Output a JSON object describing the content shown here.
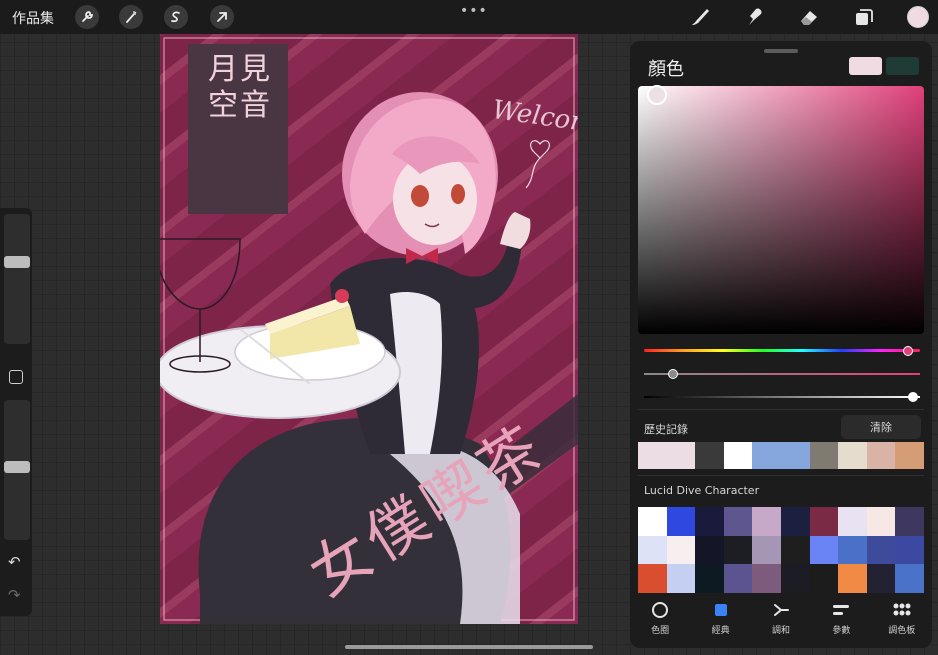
{
  "topbar": {
    "gallery_label": "作品集",
    "left_tools": [
      "wrench-icon",
      "magic-wand-icon",
      "selection-icon",
      "transform-arrow-icon"
    ],
    "right_tools": [
      "brush-icon",
      "smudge-icon",
      "eraser-icon",
      "layers-icon"
    ],
    "more_icon": "ellipsis-icon",
    "current_color": "#f0dbe2"
  },
  "sidebar": {
    "brush_size_level": 0.64,
    "opacity_level": 0.52,
    "undo_icon": "undo-icon",
    "redo_icon": "redo-icon"
  },
  "artwork": {
    "title_vertical": "月見\n空音",
    "big_title": "女僕喫茶",
    "handwriting": "Welcom"
  },
  "color_panel": {
    "title": "顏色",
    "primary_swatch": "#f0dbe2",
    "secondary_swatch": "#1f3b36",
    "hue_color": "#e0407a",
    "history_label": "歷史記錄",
    "clear_label": "清除",
    "history_swatches": [
      "#ecdce3",
      "#ecdce3",
      "#3a3a3a",
      "#ffffff",
      "#85a7dd",
      "#85a7dd",
      "#7f7a72",
      "#e4dccc",
      "#d9b3a6",
      "#d49d75"
    ],
    "palette_name": "Lucid Dive Character",
    "palette_swatches": [
      "#ffffff",
      "#2f49e0",
      "#1a1a3d",
      "#5e568f",
      "#c7a8c8",
      "#1c2040",
      "#7a2a44",
      "#e8e2f3",
      "#f7e7e5",
      "#3e3760",
      "#dde2f7",
      "#f7eeef",
      "#141628",
      "#1d1d24",
      "#a596b6",
      "#1e1e1e",
      "#6a84f5",
      "#4a70c8",
      "#3e4a9a",
      "#3b4aa0",
      "#d94e2e",
      "#c5cff2",
      "#0e1a22",
      "#5c5490",
      "#7c5b7c",
      "#1c1c24",
      "#1c1c1c",
      "#f08a44",
      "#222233",
      "#4a72c8"
    ],
    "tabs": [
      {
        "label": "色圈",
        "icon": "disc-icon"
      },
      {
        "label": "經典",
        "icon": "classic-square-icon"
      },
      {
        "label": "調和",
        "icon": "harmony-icon"
      },
      {
        "label": "參數",
        "icon": "value-sliders-icon"
      },
      {
        "label": "調色板",
        "icon": "palette-grid-icon"
      }
    ],
    "active_tab": "經典"
  }
}
